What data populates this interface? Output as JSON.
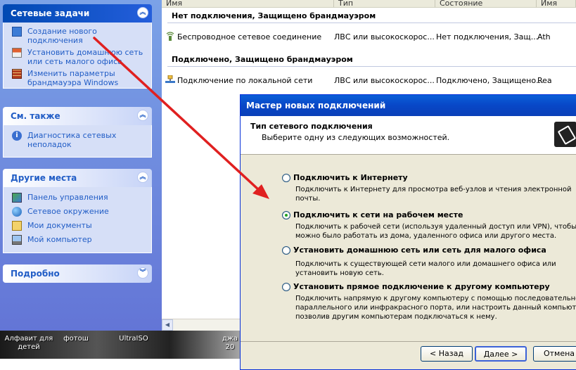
{
  "left_pane": {
    "tasks": {
      "title": "Сетевые задачи",
      "items": [
        "Создание нового подключения",
        "Установить домашнюю сеть или сеть малого офиса",
        "Изменить параметры брандмауэра Windows"
      ]
    },
    "see_also": {
      "title": "См. также",
      "items": [
        "Диагностика сетевых неполадок"
      ]
    },
    "other_places": {
      "title": "Другие места",
      "items": [
        "Панель управления",
        "Сетевое окружение",
        "Мои документы",
        "Мой компьютер"
      ]
    },
    "details": {
      "title": "Подробно"
    }
  },
  "list_view": {
    "columns": [
      "Имя",
      "Тип",
      "Состояние",
      "Имя"
    ],
    "groups": [
      {
        "title": "Нет подключения, Защищено брандмауэром",
        "row": [
          "Беспроводное сетевое соединение",
          "ЛВС или высокоскорос...",
          "Нет подключения, Защ...",
          "Ath"
        ]
      },
      {
        "title": "Подключено, Защищено брандмауэром",
        "row": [
          "Подключение по локальной сети",
          "ЛВС или высокоскорос...",
          "Подключено, Защищено...",
          "Rea"
        ]
      }
    ]
  },
  "desktop": {
    "labels": [
      "Алфавит для детей",
      "фотош",
      "UltraISO",
      "джа 20"
    ]
  },
  "wizard": {
    "title": "Мастер новых подключений",
    "header_title": "Тип сетевого подключения",
    "header_subtitle": "Выберите одну из следующих возможностей.",
    "selected_index": 1,
    "options": [
      {
        "label": "Подключить к Интернету",
        "desc": "Подключить к Интернету для просмотра веб-узлов и чтения  электронной почты."
      },
      {
        "label": "Подключить к сети на рабочем месте",
        "desc": "Подключить к рабочей сети (используя удаленный доступ или VPN), чтобы можно было работать из дома, удаленного офиса или другого места."
      },
      {
        "label": "Установить домашнюю сеть или сеть для малого офиса",
        "desc": "Подключить к существующей сети малого или домашнего офиса или установить новую сеть."
      },
      {
        "label": "Установить прямое подключение к другому компьютеру",
        "desc": "Подключить напрямую к другому компьютеру с помощью последовательного, параллельного или инфракрасного порта, или настроить данный компьютер, позволив другим  компьютерам подключаться к нему."
      }
    ],
    "buttons": {
      "back": "< Назад",
      "next": "Далее >",
      "cancel": "Отмена"
    }
  },
  "colors": {
    "annotation_arrow": "#e02020",
    "title_bar": "#0a5fd8",
    "task_link": "#215dc6"
  }
}
